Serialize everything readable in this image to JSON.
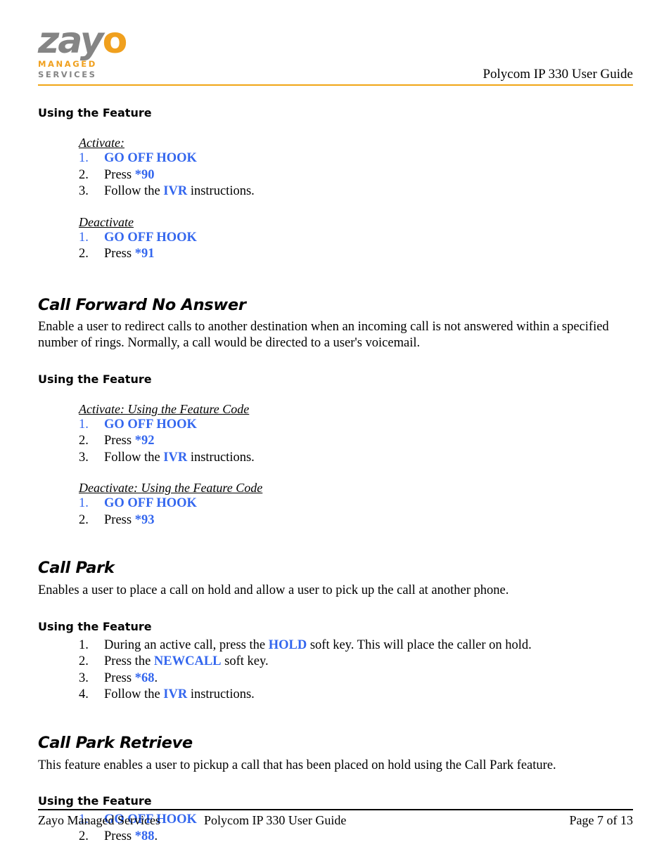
{
  "header": {
    "logo": {
      "word_main": "zay",
      "word_accent": "o",
      "tagline_top": "MANAGED",
      "tagline_bottom": "SERVICES",
      "gray": "#858585",
      "orange": "#F0A01E"
    },
    "title": "Polycom IP 330 User Guide",
    "rule_color": "#F0A515"
  },
  "colors": {
    "link_blue": "#3366EE",
    "accent_orange": "#F0A515",
    "text_black": "#000000"
  },
  "sections": [
    {
      "id": "call-forward-busy-continued",
      "heading": null,
      "subheading": "Using the Feature",
      "groups": [
        {
          "label": "Activate:",
          "steps": [
            {
              "num": "1.",
              "num_blue": true,
              "parts": [
                {
                  "text": "GO OFF HOOK",
                  "style": "blue-bold"
                }
              ]
            },
            {
              "num": "2.",
              "num_blue": false,
              "parts": [
                {
                  "text": "Press ",
                  "style": "plain"
                },
                {
                  "text": "*90",
                  "style": "blue-bold"
                }
              ]
            },
            {
              "num": "3.",
              "num_blue": false,
              "parts": [
                {
                  "text": "Follow the ",
                  "style": "plain"
                },
                {
                  "text": "IVR",
                  "style": "blue-bold"
                },
                {
                  "text": " instructions.",
                  "style": "plain"
                }
              ]
            }
          ]
        },
        {
          "label": "Deactivate",
          "steps": [
            {
              "num": "1.",
              "num_blue": true,
              "parts": [
                {
                  "text": "GO OFF HOOK",
                  "style": "blue-bold"
                }
              ]
            },
            {
              "num": "2.",
              "num_blue": false,
              "parts": [
                {
                  "text": "Press ",
                  "style": "plain"
                },
                {
                  "text": "*91",
                  "style": "blue-bold"
                }
              ]
            }
          ]
        }
      ]
    },
    {
      "id": "call-forward-no-answer",
      "heading": "Call Forward No Answer",
      "paragraph": "Enable a user to redirect calls to another destination when an incoming call is not answered within a specified number of rings.  Normally, a call would be directed to a user's voicemail.",
      "subheading": "Using the Feature",
      "groups": [
        {
          "label": "Activate: Using the Feature Code",
          "steps": [
            {
              "num": "1.",
              "num_blue": true,
              "parts": [
                {
                  "text": "GO OFF HOOK",
                  "style": "blue-bold"
                }
              ]
            },
            {
              "num": "2.",
              "num_blue": false,
              "parts": [
                {
                  "text": "Press ",
                  "style": "plain"
                },
                {
                  "text": "*92",
                  "style": "blue-bold"
                }
              ]
            },
            {
              "num": "3.",
              "num_blue": false,
              "parts": [
                {
                  "text": "Follow the ",
                  "style": "plain"
                },
                {
                  "text": "IVR",
                  "style": "blue-bold"
                },
                {
                  "text": " instructions.",
                  "style": "plain"
                }
              ]
            }
          ]
        },
        {
          "label": "Deactivate: Using the Feature Code",
          "steps": [
            {
              "num": "1.",
              "num_blue": true,
              "parts": [
                {
                  "text": "GO OFF HOOK",
                  "style": "blue-bold"
                }
              ]
            },
            {
              "num": "2.",
              "num_blue": false,
              "parts": [
                {
                  "text": "Press ",
                  "style": "plain"
                },
                {
                  "text": "*93",
                  "style": "blue-bold"
                }
              ]
            }
          ]
        }
      ]
    },
    {
      "id": "call-park",
      "heading": "Call Park",
      "paragraph": "Enables a user to place a call on hold and allow a user to pick up the call at another phone.",
      "subheading": "Using the Feature",
      "groups": [
        {
          "label": null,
          "steps": [
            {
              "num": "1.",
              "num_blue": false,
              "parts": [
                {
                  "text": "During an active call, press the ",
                  "style": "plain"
                },
                {
                  "text": "HOLD",
                  "style": "blue-bold"
                },
                {
                  "text": " soft key.  This will place the caller on hold.",
                  "style": "plain"
                }
              ]
            },
            {
              "num": "2.",
              "num_blue": false,
              "parts": [
                {
                  "text": "Press the ",
                  "style": "plain"
                },
                {
                  "text": "NEWCALL",
                  "style": "blue-bold"
                },
                {
                  "text": " soft key.",
                  "style": "plain"
                }
              ]
            },
            {
              "num": "3.",
              "num_blue": false,
              "parts": [
                {
                  "text": "Press ",
                  "style": "plain"
                },
                {
                  "text": "*68",
                  "style": "blue-bold"
                },
                {
                  "text": ".",
                  "style": "plain"
                }
              ]
            },
            {
              "num": "4.",
              "num_blue": false,
              "parts": [
                {
                  "text": "Follow the ",
                  "style": "plain"
                },
                {
                  "text": "IVR",
                  "style": "blue-bold"
                },
                {
                  "text": " instructions.",
                  "style": "plain"
                }
              ]
            }
          ]
        }
      ]
    },
    {
      "id": "call-park-retrieve",
      "heading": "Call Park Retrieve",
      "paragraph": "This feature enables a user to pickup a call that has been placed on hold using the Call Park feature.",
      "subheading": "Using the Feature",
      "groups": [
        {
          "label": null,
          "steps": [
            {
              "num": "1.",
              "num_blue": true,
              "parts": [
                {
                  "text": "GO OFF HOOK",
                  "style": "blue-bold"
                }
              ]
            },
            {
              "num": "2.",
              "num_blue": false,
              "parts": [
                {
                  "text": "Press ",
                  "style": "plain"
                },
                {
                  "text": "*88",
                  "style": "blue-bold"
                },
                {
                  "text": ".",
                  "style": "plain"
                }
              ]
            }
          ]
        }
      ]
    }
  ],
  "footer": {
    "left": "Zayo Managed Services",
    "center": "Polycom IP 330 User Guide",
    "right": "Page 7 of 13"
  }
}
